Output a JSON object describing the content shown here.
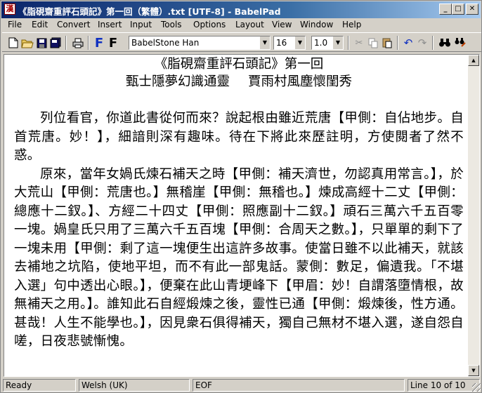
{
  "titlebar": {
    "app_icon_glyph": "漢",
    "title": "《脂硯齋重評石頭記》第一回（繁體）.txt [UTF-8] - BabelPad",
    "minimize": "_",
    "maximize": "□",
    "close": "✕"
  },
  "menu": [
    "File",
    "Edit",
    "Convert",
    "Insert",
    "Input",
    "Tools",
    "Options",
    "Layout",
    "View",
    "Window",
    "Help"
  ],
  "toolbar": {
    "font": "BabelStone Han",
    "size": "16",
    "spacing": "1.0",
    "font_button_1": "F",
    "font_button_2": "F"
  },
  "document": {
    "title_line": "《脂硯齋重評石頭記》第一回",
    "subtitle_left": "甄士隱夢幻識通靈",
    "subtitle_right": "賈雨村風塵懷閨秀",
    "paragraphs": [
      "列位看官，你道此書從何而來？說起根由雖近荒唐【甲側：自佔地步。自首荒唐。妙！】，細諳則深有趣味。待在下將此來歷註明，方使閱者了然不惑。",
      "原來，當年女媧氏煉石補天之時【甲側：補天濟世，勿認真用常言。】，於大荒山【甲側：荒唐也。】無稽崖【甲側：無稽也。】煉成高經十二丈【甲側：總應十二釵。】、方經二十四丈【甲側：照應副十二釵。】頑石三萬六千五百零一塊。媧皇氏只用了三萬六千五百塊【甲側：合周天之數。】，只單單的剩下了一塊未用【甲側：剩了這一塊便生出這許多故事。使當日雖不以此補天，就該去補地之坑陷，使地平坦，而不有此一部鬼話。蒙側：數足，偏遺我。「不堪入選」句中透出心眼。】，便棄在此山青埂峰下【甲眉：妙！自謂落墮情根，故無補天之用。】。誰知此石自經煅煉之後，靈性已通【甲側：煅煉後，性方通。甚哉！人生不能學也。】，因見衆石俱得補天，獨自己無材不堪入選，遂自怨自嗟，日夜悲號慚愧。"
    ]
  },
  "status": {
    "ready": "Ready",
    "language": "Welsh (UK)",
    "line_ending": "EOF",
    "position": "Line 10 of 10"
  }
}
